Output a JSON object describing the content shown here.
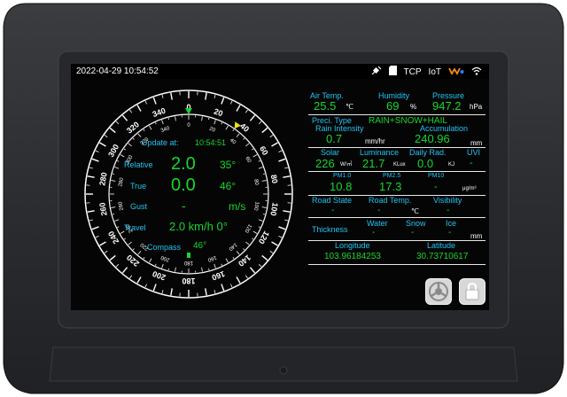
{
  "status_bar": {
    "datetime": "2022-04-29 10:54:52",
    "tcp": "TCP",
    "iot": "IoT"
  },
  "compass": {
    "heading": "0",
    "outer_ticks": [
      "0",
      "20",
      "40",
      "60",
      "80",
      "100",
      "120",
      "140",
      "160",
      "180",
      "200",
      "220",
      "240",
      "260",
      "280",
      "300",
      "320",
      "340"
    ],
    "inner_ticks": [
      "0",
      "20",
      "40",
      "60",
      "80",
      "100",
      "120",
      "140",
      "160",
      "180",
      "200",
      "220",
      "240",
      "260",
      "280",
      "300",
      "320",
      "340"
    ],
    "update_label": "Update at:",
    "update_time": "10:54:51",
    "relative_label": "Relative",
    "relative_speed": "2.0",
    "relative_dir": "35°",
    "true_label": "True",
    "true_speed": "0.0",
    "true_dir": "46°",
    "gust_label": "Gust",
    "gust_value": "-",
    "gust_unit": "m/s",
    "travel_label": "Travel",
    "travel_value": "2.0 km/h 0°",
    "compass_label": "Compass",
    "compass_value": "46°"
  },
  "weather": {
    "air_temp_label": "Air Temp.",
    "air_temp": "25.5",
    "air_temp_unit": "℃",
    "humidity_label": "Humidity",
    "humidity": "69",
    "humidity_unit": "%",
    "pressure_label": "Pressure",
    "pressure": "947.2",
    "pressure_unit": "hPa",
    "precip_type_label": "Preci. Type",
    "precip_type": "RAIN+SNOW+HAIL",
    "rain_intensity_label": "Rain Intensity",
    "rain_intensity": "0.7",
    "rain_intensity_unit": "mm/hr",
    "accumulation_label": "Accumulation",
    "accumulation": "240.96",
    "accumulation_unit": "mm",
    "solar_label": "Solar",
    "solar": "226",
    "solar_unit": "W/㎡",
    "luminance_label": "Luminance",
    "luminance": "21.7",
    "luminance_unit": "KLux",
    "daily_rad_label": "Daily Rad.",
    "daily_rad": "0.0",
    "daily_rad_unit": "KJ",
    "uvi_label": "UVI",
    "uvi": "-",
    "pm1_label": "PM1.0",
    "pm1": "10.8",
    "pm25_label": "PM2.5",
    "pm25": "17.3",
    "pm10_label": "PM10",
    "pm10": "-",
    "pm_unit": "μg/m³",
    "road_state_label": "Road State",
    "road_state": "-",
    "road_temp_label": "Road Temp.",
    "road_temp": "-",
    "road_temp_unit": "℃",
    "visibility_label": "Visibility",
    "visibility": "-",
    "thickness_label": "Thickness",
    "water_label": "Water",
    "water": "-",
    "snow_label": "Snow",
    "snow": "-",
    "ice_label": "Ice",
    "ice": "-",
    "thickness_unit": "mm",
    "longitude_label": "Longitude",
    "longitude": "103.96184253",
    "latitude_label": "Latitude",
    "latitude": "30.73710617"
  },
  "buttons": {
    "settings_icon": "settings-icon",
    "lock_icon": "lock-icon"
  }
}
